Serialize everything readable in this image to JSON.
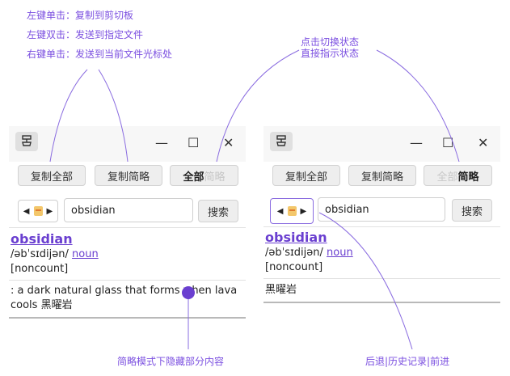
{
  "notes": {
    "left_click": "左键单击：复制到剪切板",
    "left_double": "左键双击：发送到指定文件",
    "right_click": "右键单击：发送到当前文件光标处",
    "toggle_line1": "点击切换状态",
    "toggle_line2": "直接指示状态",
    "brief_hidden": "简略模式下隐藏部分内容",
    "history": "后退|历史记录|前进"
  },
  "window": {
    "minimize_glyph": "—",
    "maximize_glyph": "☐",
    "close_glyph": "✕",
    "copy_all_label": "复制全部",
    "copy_brief_label": "复制简略",
    "search_label": "搜索",
    "history_back": "◀",
    "history_forward": "▶"
  },
  "left_window": {
    "toggle_active": "全部",
    "toggle_inactive": "简略",
    "search_value": "obsidian",
    "headword": "obsidian",
    "pronunciation": "/əbˈsɪdijən/",
    "part_of_speech": "noun",
    "grammar": "[noncount]",
    "definition_line1": ": a dark natural glass that forms when lava",
    "definition_line2": "cools 黑曜岩"
  },
  "right_window": {
    "toggle_inactive": "全部",
    "toggle_active": "简略",
    "search_value": "obsidian",
    "headword": "obsidian",
    "pronunciation": "/əbˈsɪdijən/",
    "part_of_speech": "noun",
    "grammar": "[noncount]",
    "brief_text": "黑曜岩"
  },
  "colors": {
    "annotation": "#7b4fe0",
    "link": "#6a3fd0"
  },
  "icons": {
    "app": "stamp-icon",
    "history_doc": "document-icon"
  }
}
